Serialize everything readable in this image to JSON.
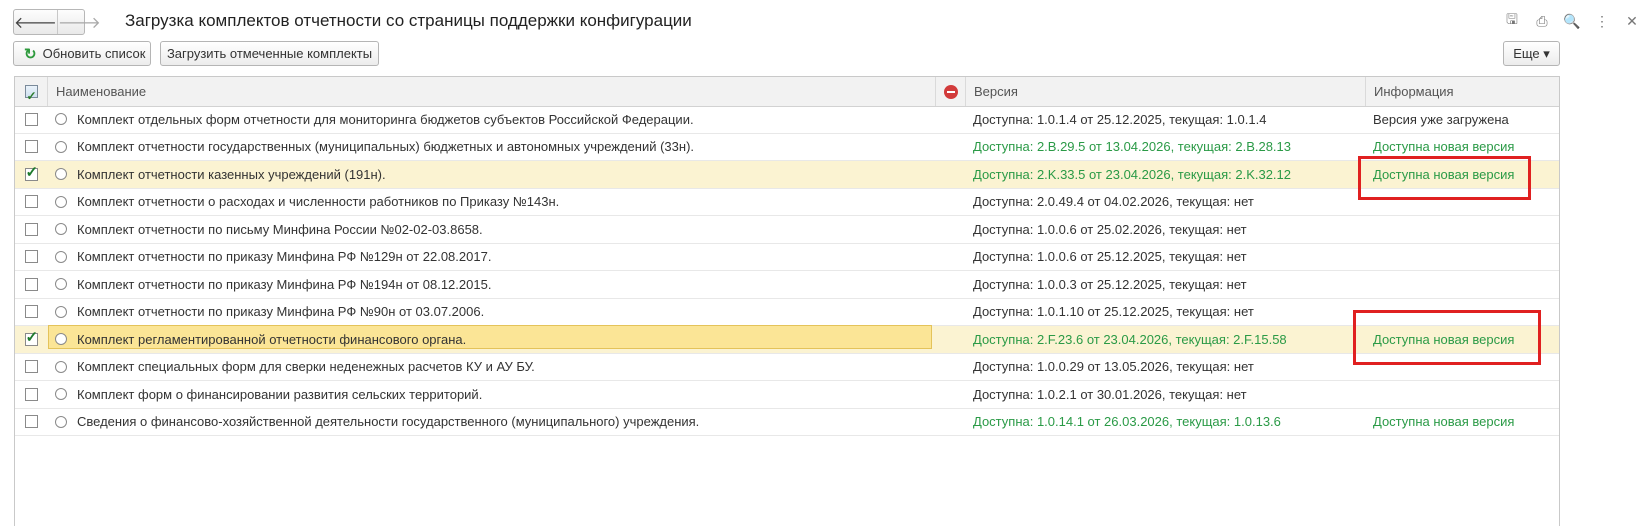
{
  "window": {
    "title": "Загрузка комплектов отчетности со страницы поддержки конфигурации"
  },
  "nav": {
    "back_icon": "arrow-left-icon",
    "forward_icon": "arrow-right-icon",
    "back_glyph": "🡐",
    "forward_glyph": "🡒"
  },
  "header_icons": [
    {
      "name": "save-icon",
      "glyph": "🖫"
    },
    {
      "name": "print-icon",
      "glyph": "⎙"
    },
    {
      "name": "preview-icon",
      "glyph": "🔍"
    },
    {
      "name": "more-vert-icon",
      "glyph": "⋮"
    },
    {
      "name": "close-icon",
      "glyph": "✕"
    }
  ],
  "toolbar": {
    "refresh_label": "Обновить список",
    "load_label": "Загрузить отмеченные комплекты",
    "more_label": "Еще ▾"
  },
  "table": {
    "columns": {
      "name": "Наименование",
      "version": "Версия",
      "info": "Информация"
    },
    "rows": [
      {
        "checked": false,
        "name": "Комплект отдельных форм отчетности для мониторинга бюджетов субъектов Российской Федерации.",
        "version": "Доступна: 1.0.1.4 от 25.12.2025, текущая: 1.0.1.4",
        "info": "Версия уже загружена",
        "new": false,
        "selected": false
      },
      {
        "checked": false,
        "name": "Комплект отчетности государственных (муниципальных) бюджетных и автономных учреждений (33н).",
        "version": "Доступна: 2.B.29.5 от 13.04.2026, текущая: 2.B.28.13",
        "info": "Доступна новая версия",
        "new": true,
        "selected": false
      },
      {
        "checked": true,
        "name": "Комплект отчетности казенных учреждений (191н).",
        "version": "Доступна: 2.K.33.5 от 23.04.2026, текущая: 2.K.32.12",
        "info": "Доступна новая версия",
        "new": true,
        "selected": true
      },
      {
        "checked": false,
        "name": "Комплект отчетности о расходах и численности работников по Приказу №143н.",
        "version": "Доступна: 2.0.49.4 от 04.02.2026, текущая: нет",
        "info": "",
        "new": false,
        "selected": false
      },
      {
        "checked": false,
        "name": "Комплект отчетности по письму Минфина России №02-02-03.8658.",
        "version": "Доступна: 1.0.0.6 от 25.02.2026, текущая: нет",
        "info": "",
        "new": false,
        "selected": false
      },
      {
        "checked": false,
        "name": "Комплект отчетности по приказу Минфина РФ №129н от 22.08.2017.",
        "version": "Доступна: 1.0.0.6 от 25.12.2025, текущая: нет",
        "info": "",
        "new": false,
        "selected": false
      },
      {
        "checked": false,
        "name": "Комплект отчетности по приказу Минфина РФ №194н от 08.12.2015.",
        "version": "Доступна: 1.0.0.3 от 25.12.2025, текущая: нет",
        "info": "",
        "new": false,
        "selected": false
      },
      {
        "checked": false,
        "name": "Комплект отчетности по приказу Минфина РФ №90н от 03.07.2006.",
        "version": "Доступна: 1.0.1.10 от 25.12.2025, текущая: нет",
        "info": "",
        "new": false,
        "selected": false
      },
      {
        "checked": true,
        "name": "Комплект регламентированной отчетности финансового органа.",
        "version": "Доступна: 2.F.23.6 от 23.04.2026, текущая: 2.F.15.58",
        "info": "Доступна новая версия",
        "new": true,
        "selected": true,
        "focused": true
      },
      {
        "checked": false,
        "name": "Комплект специальных форм для сверки неденежных расчетов КУ и АУ БУ.",
        "version": "Доступна: 1.0.0.29 от 13.05.2026, текущая: нет",
        "info": "",
        "new": false,
        "selected": false
      },
      {
        "checked": false,
        "name": "Комплект форм о финансировании развития сельских территорий.",
        "version": "Доступна: 1.0.2.1 от 30.01.2026, текущая: нет",
        "info": "",
        "new": false,
        "selected": false
      },
      {
        "checked": false,
        "name": "Сведения о финансово-хозяйственной деятельности государственного (муниципального) учреждения.",
        "version": "Доступна: 1.0.14.1 от 26.03.2026, текущая: 1.0.13.6",
        "info": "Доступна новая версия",
        "new": true,
        "selected": false
      }
    ]
  },
  "colors": {
    "accent_green": "#2a9a46",
    "selected_row": "#fbf3d2",
    "focused_cell": "#fbe596",
    "annotation_red": "#e02020"
  }
}
